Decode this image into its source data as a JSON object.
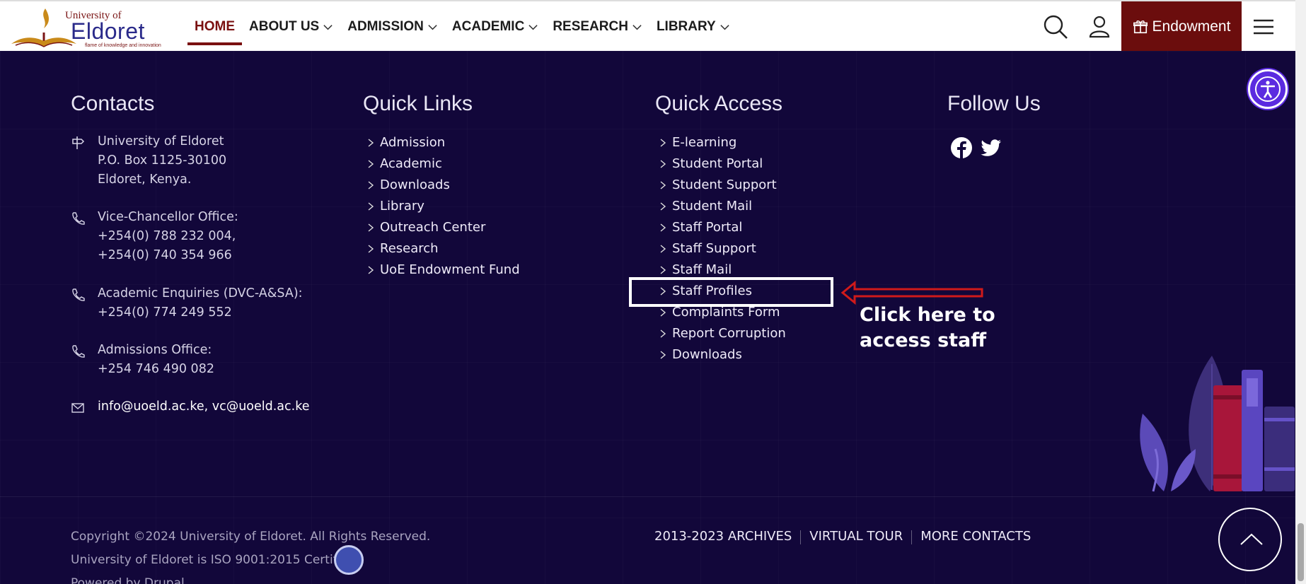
{
  "header": {
    "logo": {
      "university_of": "University of",
      "name": "Eldoret",
      "tagline": "flame of knowledge and innovation"
    },
    "nav": [
      {
        "label": "HOME",
        "active": true,
        "dropdown": false
      },
      {
        "label": "ABOUT US",
        "active": false,
        "dropdown": true
      },
      {
        "label": "ADMISSION",
        "active": false,
        "dropdown": true
      },
      {
        "label": "ACADEMIC",
        "active": false,
        "dropdown": true
      },
      {
        "label": "RESEARCH",
        "active": false,
        "dropdown": true
      },
      {
        "label": "LIBRARY",
        "active": false,
        "dropdown": true
      }
    ],
    "endowment_label": "Endowment",
    "brand_color": "#6b0d0d"
  },
  "footer": {
    "contacts": {
      "title": "Contacts",
      "address": [
        "University of Eldoret",
        "P.O. Box 1125-30100",
        "Eldoret, Kenya."
      ],
      "vc": [
        "Vice-Chancellor Office:",
        "+254(0) 788 232 004,",
        "+254(0) 740 354 966"
      ],
      "academic": [
        "Academic Enquiries (DVC-A&SA):",
        "+254(0) 774 249 552"
      ],
      "admissions": [
        "Admissions Office:",
        "+254 746 490 082"
      ],
      "email": "info@uoeld.ac.ke, vc@uoeld.ac.ke"
    },
    "quick_links": {
      "title": "Quick Links",
      "items": [
        "Admission",
        "Academic",
        "Downloads",
        "Library",
        "Outreach Center",
        "Research",
        "UoE Endowment Fund"
      ]
    },
    "quick_access": {
      "title": "Quick Access",
      "items": [
        "E-learning",
        "Student Portal",
        "Student Support",
        "Student Mail",
        "Staff Portal",
        "Staff Support",
        "Staff Mail",
        "Staff Profiles",
        "Complaints Form",
        "Report Corruption",
        "Downloads"
      ]
    },
    "follow_us": {
      "title": "Follow Us",
      "icons": [
        "facebook-icon",
        "twitter-icon"
      ]
    },
    "annotation": [
      "Click here to",
      "access staff"
    ],
    "copyright": "Copyright ©2024 University of Eldoret. All Rights Reserved.",
    "iso": "University of Eldoret is ISO 9001:2015 Certified",
    "powered": "Powered by Drupal",
    "bottom_links": [
      "2013-2023 ARCHIVES",
      "VIRTUAL TOUR",
      "MORE CONTACTS"
    ],
    "background_color": "#12073a"
  }
}
